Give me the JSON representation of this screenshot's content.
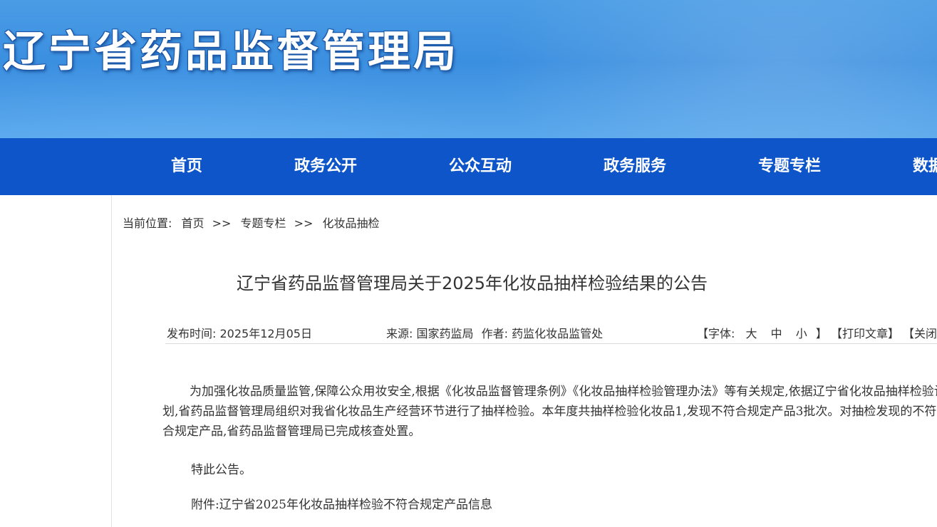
{
  "header": {
    "site_title": "辽宁省药品监督管理局"
  },
  "nav": {
    "items": [
      {
        "label": "首页"
      },
      {
        "label": "政务公开"
      },
      {
        "label": "公众互动"
      },
      {
        "label": "政务服务"
      },
      {
        "label": "专题专栏"
      },
      {
        "label": "数据"
      }
    ]
  },
  "breadcrumb": {
    "prefix": "当前位置:",
    "items": [
      "首页",
      "专题专栏",
      "化妆品抽检"
    ],
    "separator": ">>"
  },
  "article": {
    "title": "辽宁省药品监督管理局关于2025年化妆品抽样检验结果的公告",
    "publish_label": "发布时间:",
    "publish_date": "2025年12月05日",
    "source_label": "来源:",
    "source": "国家药监局",
    "author_label": "作者:",
    "author": "药监化妆品监管处",
    "tools": {
      "font_label": "【字体:",
      "font_large": "大",
      "font_medium": "中",
      "font_small": "小",
      "font_close": "】",
      "print": "【打印文章】",
      "close": "【关闭窗口】"
    },
    "paragraph1": "为加强化妆品质量监管,保障公众用妆安全,根据《化妆品监督管理条例》《化妆品抽样检验管理办法》等有关规定,依据辽宁省化妆品抽样检验计划,省药品监督管理局组织对我省化妆品生产经营环节进行了抽样检验。本年度共抽样检验化妆品1,发现不符合规定产品3批次。对抽检发现的不符合规定产品,省药品监督管理局已完成核查处置。",
    "notice": "特此公告。",
    "attachment": "附件:辽宁省2025年化妆品抽样检验不符合规定产品信息"
  },
  "colors": {
    "nav_bg": "#0d55c8",
    "banner_bg": "#3b8fe0"
  }
}
